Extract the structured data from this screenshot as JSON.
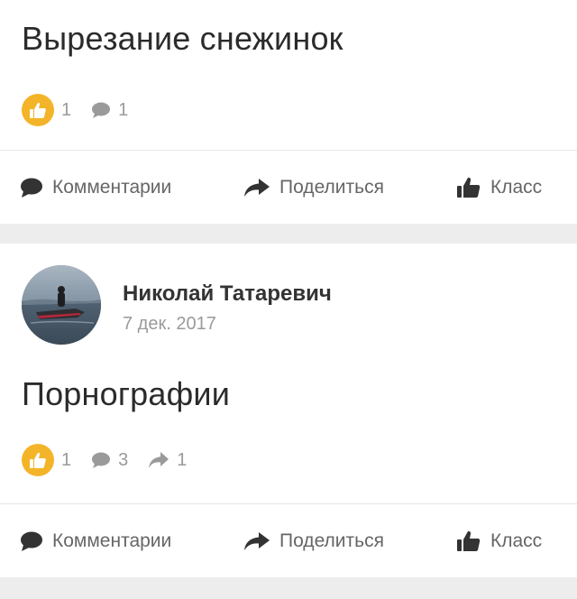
{
  "post1": {
    "text": "Вырезание снежинок",
    "likes": "1",
    "comments": "1"
  },
  "post2": {
    "author": "Николай Татаревич",
    "date": "7 дек. 2017",
    "text": "Порнографии",
    "likes": "1",
    "comments": "3",
    "shares": "1"
  },
  "actions": {
    "comments_label": "Комментарии",
    "share_label": "Поделиться",
    "class_label": "Класс"
  },
  "colors": {
    "like_badge": "#f4b429",
    "icon_gray": "#9a9a9a",
    "action_dark": "#333333",
    "separator": "#e6e6e6",
    "gap": "#ededed"
  }
}
